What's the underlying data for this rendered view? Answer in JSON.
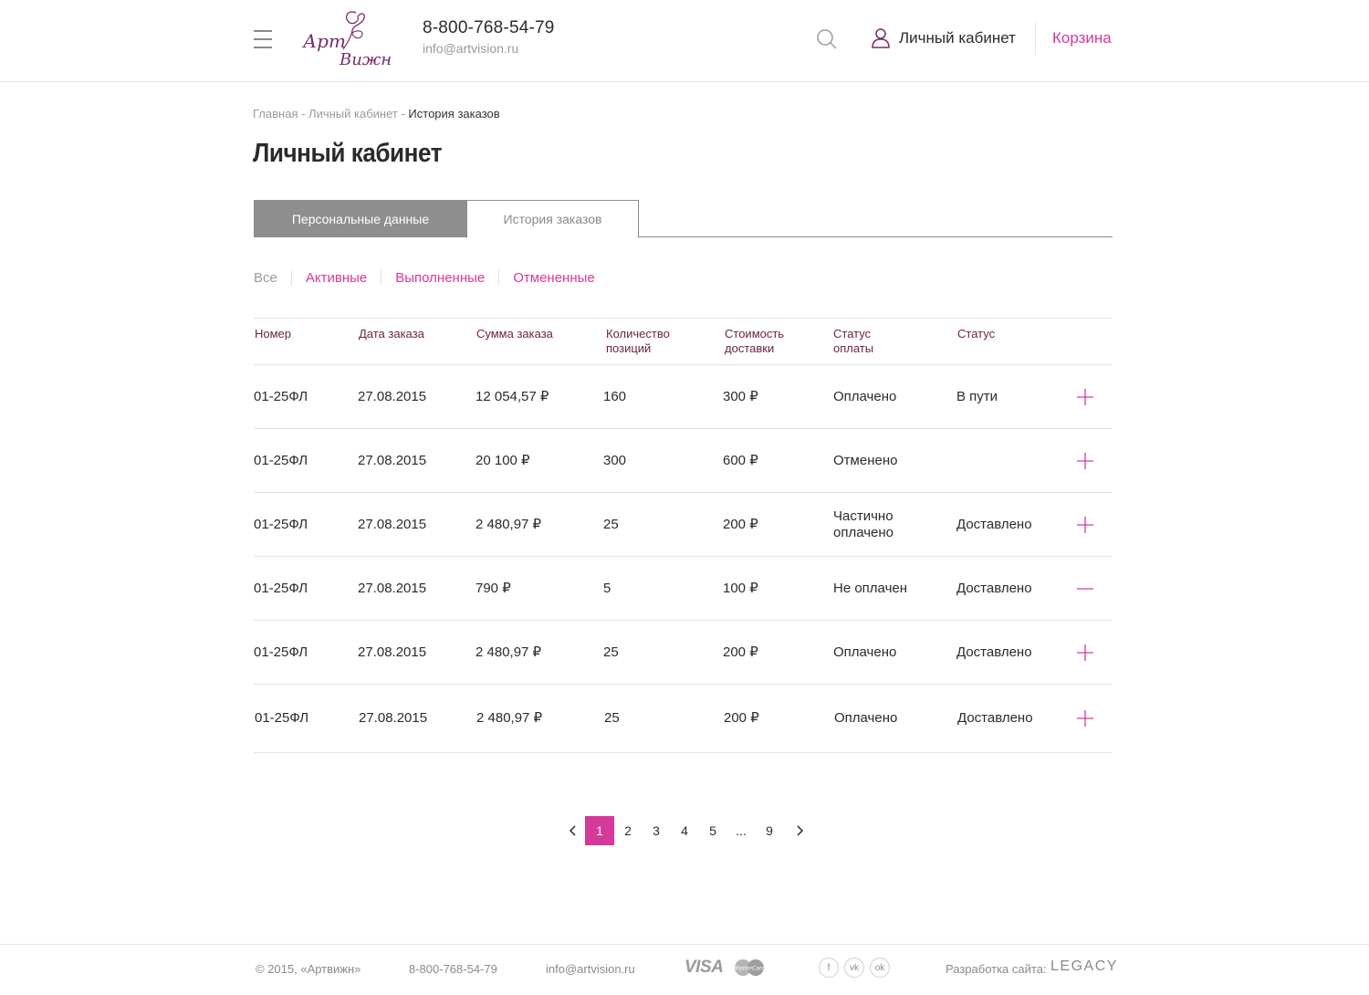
{
  "header": {
    "logo_line1": "Арт",
    "logo_line2": "Вижн",
    "phone": "8-800-768-54-79",
    "email": "info@artvision.ru",
    "account_label": "Личный кабинет",
    "cart_label": "Корзина"
  },
  "breadcrumb": {
    "home": "Главная",
    "sep": " - ",
    "account": "Личный кабинет",
    "current": "История заказов"
  },
  "page_title": "Личный кабинет",
  "tabs": [
    {
      "label": "Персональные данные",
      "state": "filled"
    },
    {
      "label": "История заказов",
      "state": "active"
    }
  ],
  "filters": [
    {
      "label": "Все",
      "active": true
    },
    {
      "label": "Активные",
      "active": false
    },
    {
      "label": "Выполненные",
      "active": false
    },
    {
      "label": "Отмененные",
      "active": false
    }
  ],
  "table": {
    "columns": [
      "Номер",
      "Дата заказа",
      "Сумма заказа",
      "Количество позиций",
      "Стоимость доставки",
      "Статус оплаты",
      "Статус"
    ],
    "rows": [
      {
        "number": "01-25ФЛ",
        "date": "27.08.2015",
        "sum": "12 054,57 ₽",
        "qty": "160",
        "delivery": "300 ₽",
        "payment": "Оплачено",
        "status": "В пути",
        "expanded": false
      },
      {
        "number": "01-25ФЛ",
        "date": "27.08.2015",
        "sum": "20 100 ₽",
        "qty": "300",
        "delivery": "600 ₽",
        "payment": "Отменено",
        "status": "",
        "expanded": false
      },
      {
        "number": "01-25ФЛ",
        "date": "27.08.2015",
        "sum": "2 480,97 ₽",
        "qty": "25",
        "delivery": "200 ₽",
        "payment": "Частично оплачено",
        "status": "Доставлено",
        "expanded": false
      },
      {
        "number": "01-25ФЛ",
        "date": "27.08.2015",
        "sum": "790 ₽",
        "qty": "5",
        "delivery": "100 ₽",
        "payment": "Не оплачен",
        "status": "Доставлено",
        "expanded": true
      },
      {
        "number": "01-25ФЛ",
        "date": "27.08.2015",
        "sum": "2 480,97 ₽",
        "qty": "25",
        "delivery": "200 ₽",
        "payment": "Оплачено",
        "status": "Доставлено",
        "expanded": false
      },
      {
        "number": "01-25ФЛ",
        "date": "27.08.2015",
        "sum": "2 480,97 ₽",
        "qty": "25",
        "delivery": "200 ₽",
        "payment": "Оплачено",
        "status": "Доставлено",
        "expanded": false
      }
    ]
  },
  "pagination": {
    "pages": [
      "1",
      "2",
      "3",
      "4",
      "5",
      "...",
      "9"
    ],
    "current": "1"
  },
  "footer": {
    "copyright": "© 2015, «Артвижн»",
    "phone": "8-800-768-54-79",
    "email": "info@artvision.ru",
    "visa": "VISA",
    "mastercard": "MasterCard",
    "social": [
      "f",
      "vk",
      "ok"
    ],
    "dev_label": "Разработка сайта:",
    "dev_name": "LEGACY"
  },
  "colors": {
    "accent": "#d6399a",
    "header_text": "#6c2346",
    "tab_fill": "#8e8e8e",
    "logo": "#7a2a6a"
  }
}
